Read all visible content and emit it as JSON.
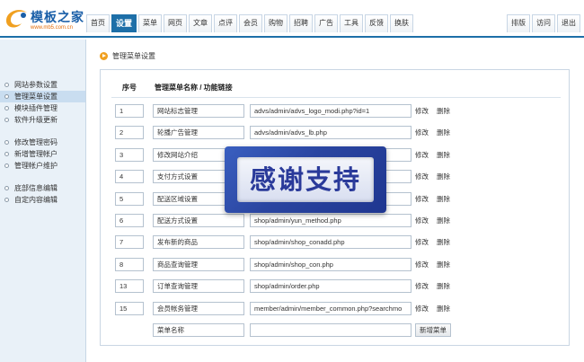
{
  "header": {
    "logo_title": "模板之家",
    "logo_url": "www.mb5.com.cn",
    "nav": [
      "首页",
      "设置",
      "菜单",
      "网页",
      "文章",
      "点评",
      "会员",
      "购物",
      "招聘",
      "广告",
      "工具",
      "反馈",
      "换肤"
    ],
    "active_index": 1,
    "nav_right": [
      "排版",
      "访问",
      "退出"
    ]
  },
  "sidebar": {
    "groups": [
      [
        "网站参数设置",
        "管理菜单设置",
        "模块插件管理",
        "软件升级更新"
      ],
      [
        "修改管理密码",
        "新增管理帐户",
        "管理帐户维护"
      ],
      [
        "底部信息编辑",
        "自定内容编辑"
      ]
    ],
    "active": "管理菜单设置"
  },
  "main": {
    "title": "管理菜单设置",
    "col_no": "序号",
    "col_name": "管理菜单名称 / 功能链接",
    "rows": [
      {
        "no": "1",
        "name": "网站标志管理",
        "link": "advs/admin/advs_logo_modi.php?id=1"
      },
      {
        "no": "2",
        "name": "轮播广告管理",
        "link": "advs/admin/advs_lb.php"
      },
      {
        "no": "3",
        "name": "修改网站介绍",
        "link": ""
      },
      {
        "no": "4",
        "name": "支付方式设置",
        "link": ""
      },
      {
        "no": "5",
        "name": "配送区域设置",
        "link": ""
      },
      {
        "no": "6",
        "name": "配送方式设置",
        "link": "shop/admin/yun_method.php"
      },
      {
        "no": "7",
        "name": "发布新的商品",
        "link": "shop/admin/shop_conadd.php"
      },
      {
        "no": "8",
        "name": "商品查询管理",
        "link": "shop/admin/shop_con.php"
      },
      {
        "no": "13",
        "name": "订单查询管理",
        "link": "shop/admin/order.php"
      },
      {
        "no": "15",
        "name": "会员帐务管理",
        "link": "member/admin/member_common.php?searchmo"
      }
    ],
    "edit_label": "修改",
    "delete_label": "删除",
    "new_name": "菜单名称",
    "new_link": "",
    "add_label": "新增菜单"
  },
  "overlay": {
    "text": "感谢支持"
  },
  "colors": {
    "brand": "#1d6fa8",
    "sidebar_bg": "#e9f1f8",
    "overlay": "#2a45a0"
  }
}
